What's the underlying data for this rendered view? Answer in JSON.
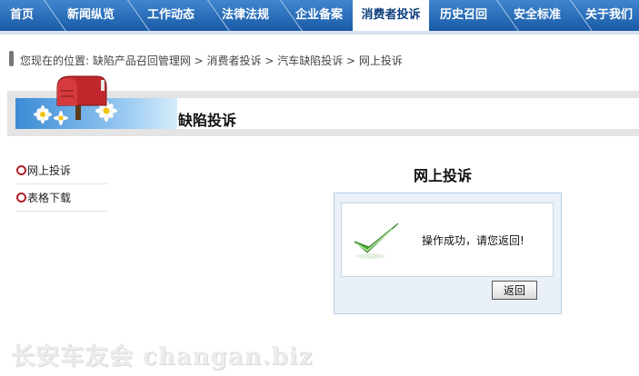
{
  "nav": {
    "items": [
      {
        "label": "首页"
      },
      {
        "label": "新闻纵览"
      },
      {
        "label": "工作动态"
      },
      {
        "label": "法律法规"
      },
      {
        "label": "企业备案"
      },
      {
        "label": "消费者投诉"
      },
      {
        "label": "历史召回"
      },
      {
        "label": "安全标准"
      },
      {
        "label": "关于我们"
      }
    ],
    "active_index": 5,
    "colors": {
      "bar": "#1e5fa8",
      "active_bg": "#ffffff",
      "active_text": "#0d3e7c"
    }
  },
  "breadcrumb": {
    "text": "您现在的位置: 缺陷产品召回管理网 > 消费者投诉 > 汽车缺陷投诉 > 网上投诉"
  },
  "banner": {
    "title": "缺陷投诉",
    "icon": "mailbox-icon"
  },
  "sidebar": {
    "items": [
      {
        "label": "网上投诉"
      },
      {
        "label": "表格下载"
      }
    ]
  },
  "main": {
    "title": "网上投诉",
    "message": "操作成功，请您返回!",
    "back_button": "返回",
    "status_icon": "checkmark-icon"
  },
  "watermark": {
    "text": "长安车友会 changan.biz"
  }
}
